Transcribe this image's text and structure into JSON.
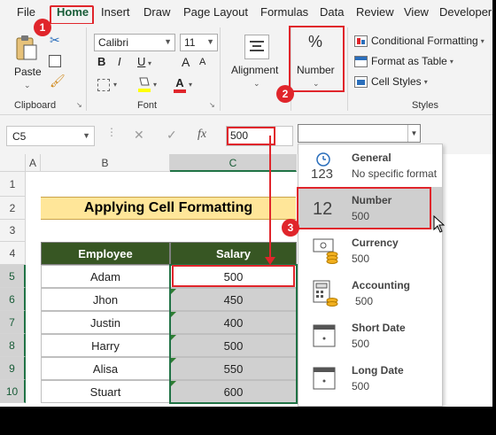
{
  "menu": {
    "tabs": [
      "File",
      "Home",
      "Insert",
      "Draw",
      "Page Layout",
      "Formulas",
      "Data",
      "Review",
      "View",
      "Developer"
    ],
    "active": "Home"
  },
  "ribbon": {
    "clipboard": {
      "paste_label": "Paste",
      "group_label": "Clipboard"
    },
    "font": {
      "font_name": "Calibri",
      "font_size": "11",
      "bold": "B",
      "italic": "I",
      "underline": "U",
      "grow": "A",
      "shrink": "A",
      "font_color_glyph": "A",
      "group_label": "Font"
    },
    "alignment": {
      "label": "Alignment"
    },
    "number": {
      "label": "Number",
      "icon_glyph": "%"
    },
    "styles": {
      "conditional": "Conditional Formatting",
      "table": "Format as Table",
      "cell_styles": "Cell Styles",
      "group_label": "Styles"
    }
  },
  "formula_bar": {
    "name_box": "C5",
    "fx": "fx",
    "cancel": "✕",
    "enter": "✓",
    "value": "500"
  },
  "grid": {
    "columns": [
      "A",
      "B",
      "C"
    ],
    "rows": [
      "1",
      "2",
      "3",
      "4",
      "5",
      "6",
      "7",
      "8",
      "9",
      "10"
    ],
    "title": "Applying Cell Formatting",
    "headers": {
      "employee": "Employee",
      "salary": "Salary"
    },
    "data": [
      {
        "employee": "Adam",
        "salary": "500"
      },
      {
        "employee": "Jhon",
        "salary": "450"
      },
      {
        "employee": "Justin",
        "salary": "400"
      },
      {
        "employee": "Harry",
        "salary": "500"
      },
      {
        "employee": "Alisa",
        "salary": "550"
      },
      {
        "employee": "Stuart",
        "salary": "600"
      }
    ]
  },
  "number_format_dropdown": {
    "combo_value": "",
    "items": [
      {
        "name": "General",
        "sample": "No specific format",
        "icon": "general-123-icon",
        "icon_glyph": "123"
      },
      {
        "name": "Number",
        "sample": "500",
        "icon": "number-12-icon",
        "icon_glyph": "12"
      },
      {
        "name": "Currency",
        "sample": "500",
        "icon": "currency-icon"
      },
      {
        "name": "Accounting",
        "sample": "500",
        "icon": "accounting-icon"
      },
      {
        "name": "Short Date",
        "sample": "500",
        "icon": "short-date-icon"
      },
      {
        "name": "Long Date",
        "sample": "500",
        "icon": "long-date-icon"
      }
    ],
    "highlighted": "Number"
  },
  "callouts": [
    "1",
    "2",
    "3"
  ],
  "colors": {
    "accent_green": "#217346",
    "header_fill": "#375623",
    "title_fill": "#ffe699",
    "annotation_red": "#e0252b"
  }
}
